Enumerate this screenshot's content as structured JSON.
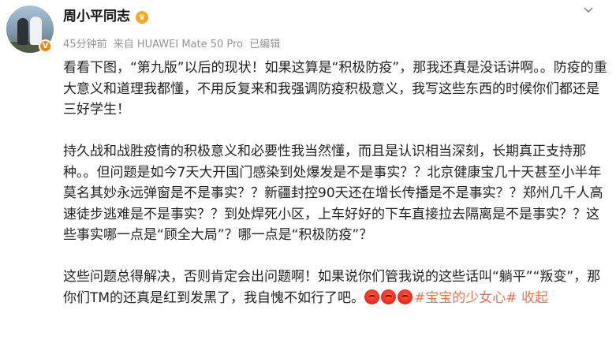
{
  "post": {
    "author": "周小平同志",
    "time": "45分钟前",
    "source": "来自 HUAWEI Mate 50 Pro",
    "edited": "已编辑",
    "paragraphs": [
      [
        "看看下图，“第九版”以后的现状！如果这算是“积极防疫”，那我还真是没话讲啊。。防疫的重大意义和道理我都懂，不用反复来和我强调防疫积极意义，我写这些东西的时候你们都还是三好学生！"
      ],
      [
        "持久战和战胜疫情的积极意义和必要性我当然懂，而且是认识相当深刻，长期真正支持那种。。但问题是如今7天大开国门感染到处爆发是不是事实？？北京健康宝几十天甚至小半年莫名其妙永远弹窗是不是事实？？新疆封控90天还在增长传播是不是事实？？郑州几千人高速徒步逃难是不是事实？？到处焊死小区，上车好好的下车直接拉去隔离是不是事实？？这些事实哪一点是“顾全大局”？哪一点是“积极防疫”？"
      ],
      [
        "这些问题总得解决，否则肯定会出问题啊！如果说你们管我说的这些话叫“躺平”“叛变”，那你们TM的还真是红到发黑了，我自愧不如行了吧。"
      ]
    ],
    "emoji_name": "angry-face-emoji",
    "topic": "#宝宝的少女心#",
    "collapse": "收起"
  },
  "badges": {
    "verified": "V",
    "crown_icon": "crown-icon"
  },
  "colors": {
    "accent": "#eb7350",
    "meta": "#939393",
    "verified": "#ff8200"
  }
}
